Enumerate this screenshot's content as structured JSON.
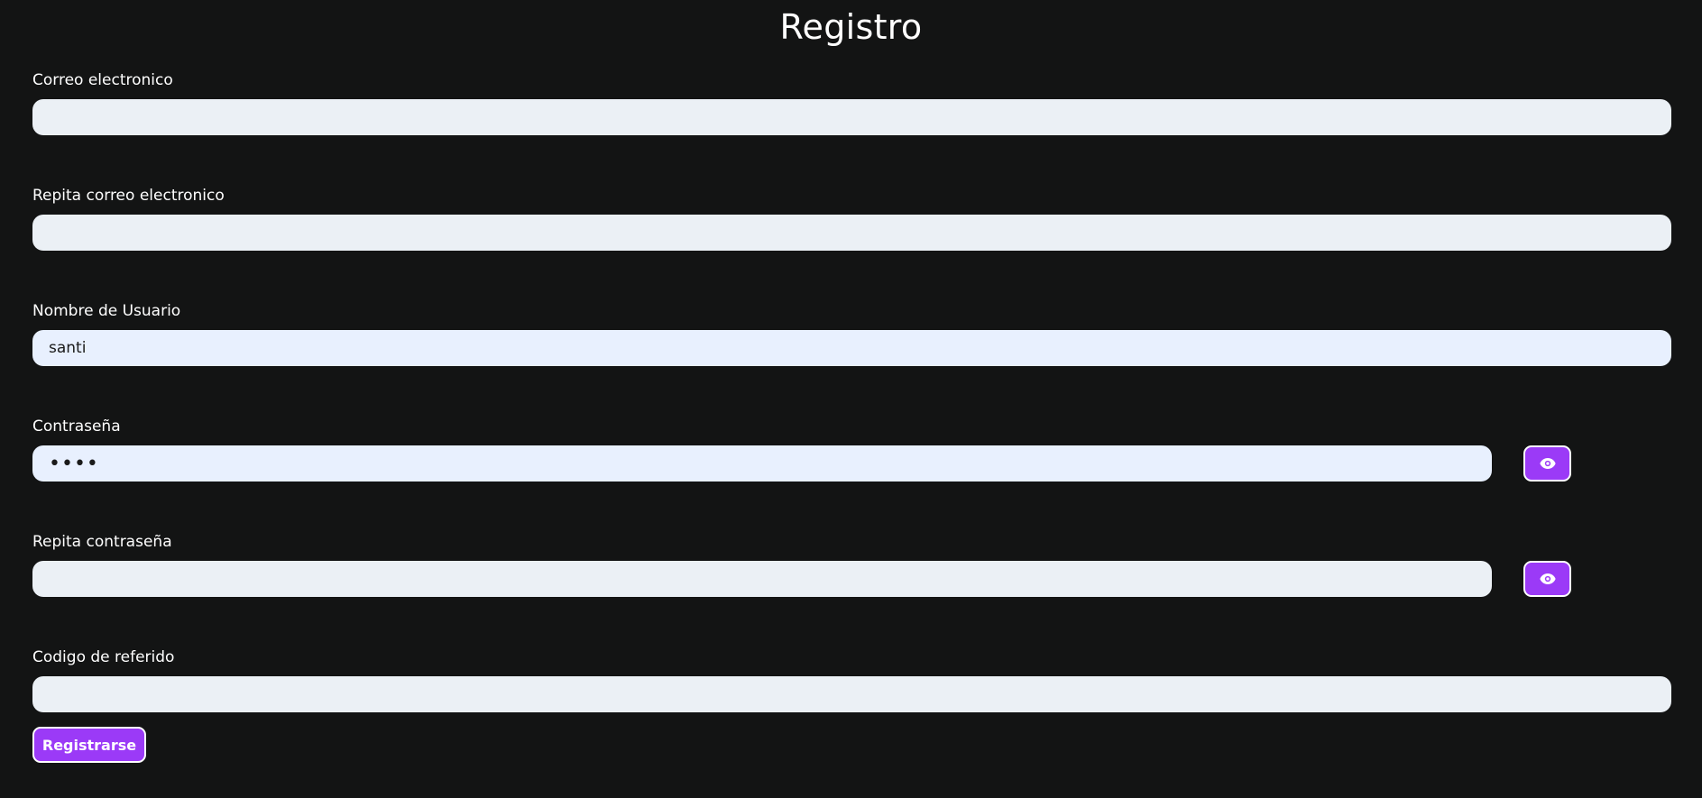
{
  "page": {
    "title": "Registro"
  },
  "form": {
    "email": {
      "label": "Correo electronico",
      "value": ""
    },
    "email_repeat": {
      "label": "Repita correo electronico",
      "value": ""
    },
    "username": {
      "label": "Nombre de Usuario",
      "value": "santi"
    },
    "password": {
      "label": "Contraseña",
      "value": "••••",
      "toggle_icon": "eye-icon"
    },
    "password_repeat": {
      "label": "Repita contraseña",
      "value": "",
      "toggle_icon": "eye-icon"
    },
    "referral_code": {
      "label": "Codigo de referido",
      "value": ""
    },
    "submit_label": "Registrarse"
  },
  "colors": {
    "background": "#131414",
    "accent": "#9b3af7",
    "input_empty": "#ebf0f5",
    "input_filled": "#e8f0fe"
  }
}
